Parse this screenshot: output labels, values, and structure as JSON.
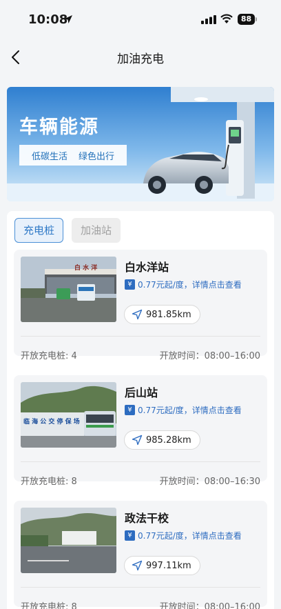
{
  "status": {
    "time": "10:08",
    "battery": "88"
  },
  "nav": {
    "title": "加油充电"
  },
  "banner": {
    "title": "车辆能源",
    "tag_left": "低碳生活",
    "tag_right": "绿色出行"
  },
  "tabs": [
    {
      "label": "充电桩",
      "active": true
    },
    {
      "label": "加油站",
      "active": false
    }
  ],
  "stations": [
    {
      "name": "白水洋站",
      "price": "0.77元起/度，详情点击查看",
      "distance": "981.85km",
      "open_piles": "开放充电桩: 4",
      "open_hours": "开放时间：08:00–16:00",
      "sign_text": "白 水 洋"
    },
    {
      "name": "后山站",
      "price": "0.77元起/度，详情点击查看",
      "distance": "985.28km",
      "open_piles": "开放充电桩: 8",
      "open_hours": "开放时间：08:00–16:30",
      "sign_text": "临 海 公 交 停 保 场"
    },
    {
      "name": "政法干校",
      "price": "0.77元起/度，详情点击查看",
      "distance": "997.11km",
      "open_piles": "开放充电桩: 8",
      "open_hours": "开放时间：08:00–16:00"
    }
  ],
  "icons": {
    "price": "yuan-icon",
    "distance": "navigation-arrow-icon"
  }
}
